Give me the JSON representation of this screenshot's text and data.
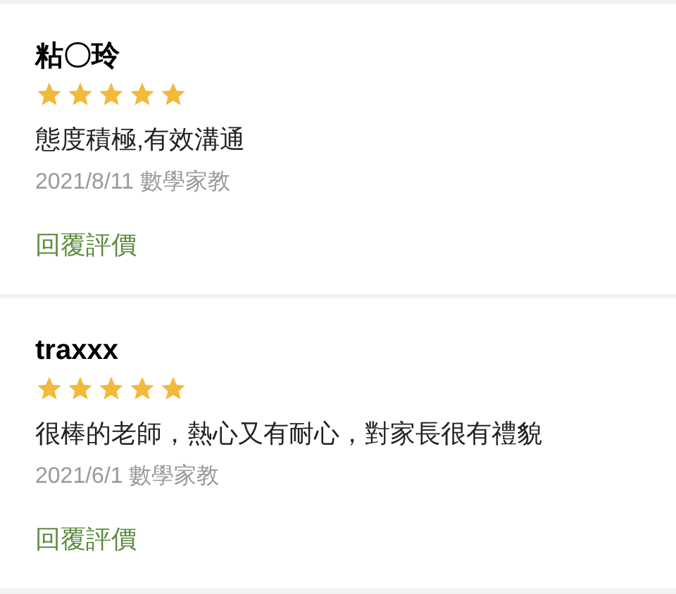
{
  "reviews": [
    {
      "name": "粘〇玲",
      "stars": 5,
      "comment": "態度積極,有效溝通",
      "date": "2021/8/11 數學家教",
      "reply": "回覆評價"
    },
    {
      "name": "traxxx",
      "stars": 5,
      "comment": "很棒的老師，熱心又有耐心，對家長很有禮貌",
      "date": "2021/6/1 數學家教",
      "reply": "回覆評價"
    }
  ]
}
